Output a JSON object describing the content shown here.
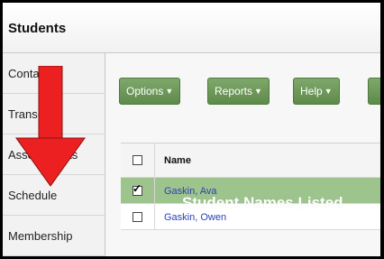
{
  "header": {
    "title": "Students"
  },
  "sidebar": {
    "items": [
      {
        "label": "Contact"
      },
      {
        "label": "Transcript"
      },
      {
        "label": "Assessments"
      },
      {
        "label": "Schedule"
      },
      {
        "label": "Membership"
      }
    ]
  },
  "toolbar": {
    "buttons": [
      {
        "label": "Options"
      },
      {
        "label": "Reports"
      },
      {
        "label": "Help"
      }
    ]
  },
  "table": {
    "header": {
      "name": "Name"
    },
    "rows": [
      {
        "name": "Gaskin, Ava",
        "checked": true
      },
      {
        "name": "Gaskin, Owen",
        "checked": false
      }
    ]
  },
  "annotation": {
    "text": "Student Names Listed",
    "arrow_color": "#ec2020"
  },
  "colors": {
    "button_green": "#6a9a55",
    "selected_row": "#9ec48d",
    "link_blue": "#2a3fb5"
  }
}
